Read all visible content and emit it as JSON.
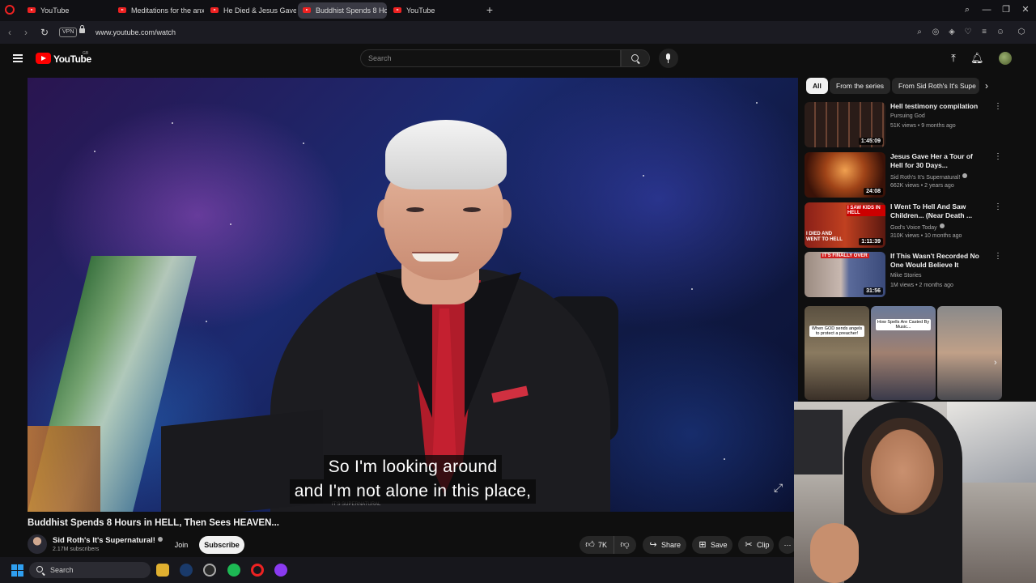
{
  "browser": {
    "tabs": [
      {
        "label": "YouTube",
        "active": false
      },
      {
        "label": "Meditations for the anxio",
        "active": false
      },
      {
        "label": "He Died & Jesus Gave Hir",
        "active": false
      },
      {
        "label": "Buddhist Spends 8 Ho",
        "active": true
      },
      {
        "label": "YouTube",
        "active": false
      }
    ],
    "vpn": "VPN",
    "url": "www.youtube.com/watch"
  },
  "header": {
    "logo": "YouTube",
    "region": "GB",
    "search_placeholder": "Search"
  },
  "player": {
    "caption_line1": "So I'm looking around",
    "caption_line2": "and I'm not alone in this place,",
    "watermark": "IT'S SUPERNATURAL"
  },
  "video": {
    "title": "Buddhist Spends 8 Hours in HELL, Then Sees HEAVEN...",
    "channel": "Sid Roth's It's Supernatural!",
    "subscribers": "2.17M subscribers",
    "join_label": "Join",
    "subscribe_label": "Subscribe",
    "likes": "7K",
    "share_label": "Share",
    "save_label": "Save",
    "clip_label": "Clip"
  },
  "chips": [
    {
      "label": "All",
      "active": true
    },
    {
      "label": "From the series",
      "active": false
    },
    {
      "label": "From Sid Roth's It's Supe",
      "active": false
    }
  ],
  "recommendations": [
    {
      "title": "Hell testimony compilation",
      "channel": "Pursuing God",
      "meta": "51K views • 9 months ago",
      "duration": "1:45:09"
    },
    {
      "title": "Jesus Gave Her a Tour of Hell for 30 Days...",
      "channel": "Sid Roth's It's Supernatural!",
      "meta": "662K views • 2 years ago",
      "duration": "24:08"
    },
    {
      "title": "I Went To Hell And Saw Children... (Near Death ...",
      "channel": "God's Voice Today",
      "meta": "310K views • 10 months ago",
      "duration": "1:11:39",
      "thumb_text_top": "I SAW KIDS IN HELL",
      "thumb_text_bottom": "I DIED AND WENT TO HELL"
    },
    {
      "title": "If This Wasn't Recorded No One Would Believe It",
      "channel": "Mike Stories",
      "meta": "1M views • 2 months ago",
      "duration": "31:56",
      "thumb_text_top": "IT'S FINALLY OVER"
    }
  ],
  "shorts": [
    {
      "caption": "When GOD sends angels to protect a preacher!"
    },
    {
      "caption": "How Spells Are Casted By Music..."
    },
    {
      "caption": ""
    }
  ],
  "taskbar": {
    "search_label": "Search"
  },
  "colors": {
    "accent": "#ff0000",
    "background": "#0f0f0f",
    "text": "#f1f1f1",
    "secondary_text": "#aaaaaa"
  }
}
